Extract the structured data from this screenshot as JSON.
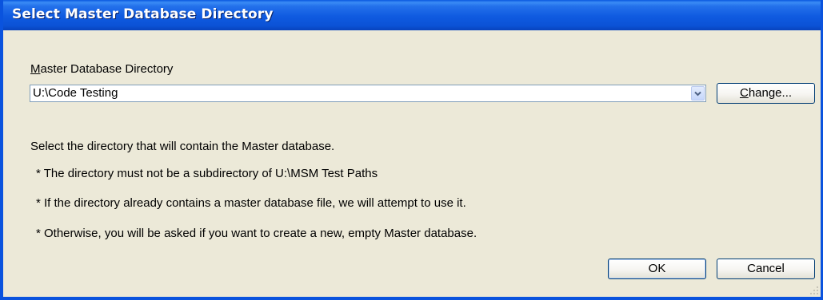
{
  "window": {
    "title": "Select Master Database Directory"
  },
  "form": {
    "field_label": "Master Database Directory",
    "directory_value": "U:\\Code Testing",
    "change_button": "Change..."
  },
  "info": {
    "description": "Select the directory that will contain the Master database.",
    "bullets": [
      "* The directory must not be a subdirectory of U:\\MSM Test Paths",
      "* If the directory already contains a master database file, we will attempt to use it.",
      "* Otherwise, you will be asked if you want to create a new, empty Master database."
    ]
  },
  "buttons": {
    "ok": "OK",
    "cancel": "Cancel"
  },
  "icons": {
    "dropdown": "chevron-down-icon",
    "resize": "resize-grip-icon"
  },
  "colors": {
    "titlebar": "#0a58e0",
    "dialog_bg": "#ece9d8",
    "button_border": "#003c74"
  }
}
